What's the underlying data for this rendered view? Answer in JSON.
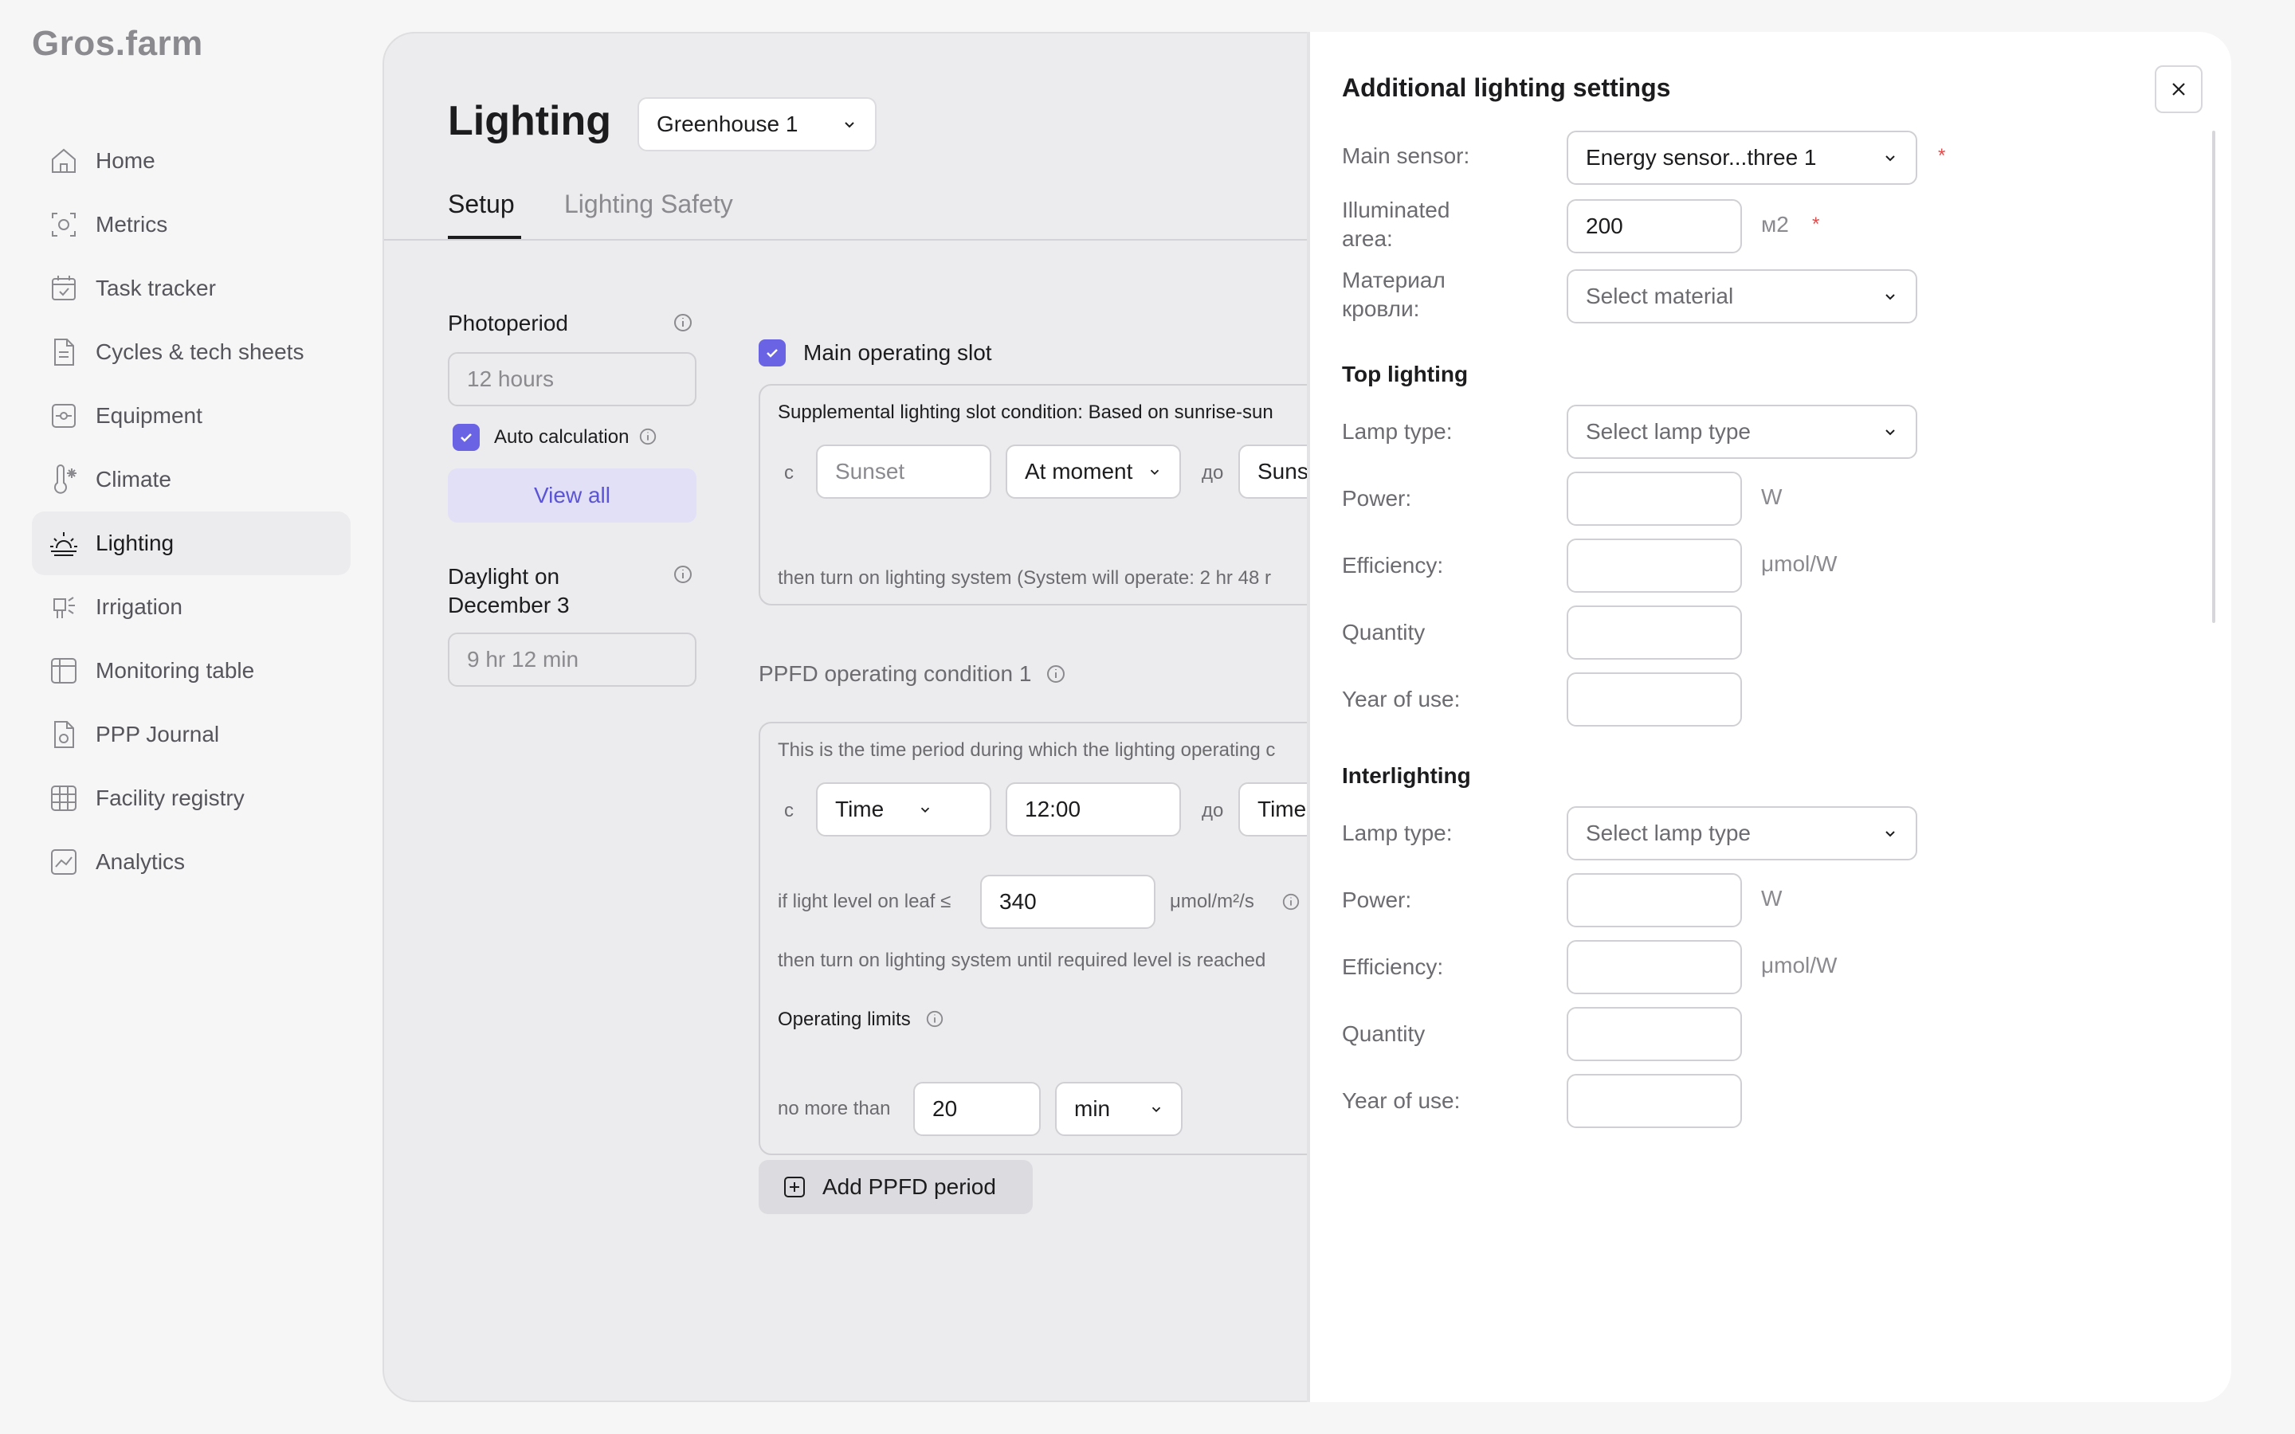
{
  "app": {
    "logo": "Gros.farm"
  },
  "sidebar": {
    "items": [
      {
        "label": "Home",
        "icon": "home-icon"
      },
      {
        "label": "Metrics",
        "icon": "metrics-icon"
      },
      {
        "label": "Task tracker",
        "icon": "calendar-check-icon"
      },
      {
        "label": "Cycles & tech sheets",
        "icon": "document-icon"
      },
      {
        "label": "Equipment",
        "icon": "equipment-icon"
      },
      {
        "label": "Climate",
        "icon": "thermometer-icon"
      },
      {
        "label": "Lighting",
        "icon": "sunrise-icon",
        "active": true
      },
      {
        "label": "Irrigation",
        "icon": "irrigation-icon"
      },
      {
        "label": "Monitoring table",
        "icon": "table-icon"
      },
      {
        "label": "PPP Journal",
        "icon": "journal-icon"
      },
      {
        "label": "Facility registry",
        "icon": "grid-icon"
      },
      {
        "label": "Analytics",
        "icon": "analytics-icon"
      }
    ]
  },
  "main": {
    "title": "Lighting",
    "greenhouse": "Greenhouse 1",
    "tabs": [
      {
        "label": "Setup",
        "active": true
      },
      {
        "label": "Lighting Safety"
      }
    ],
    "photoperiod": {
      "label": "Photoperiod",
      "value": "12 hours",
      "auto_calc_label": "Auto calculation",
      "view_all": "View all"
    },
    "daylight": {
      "label": "Daylight on December 3",
      "value": "9 hr 12 min"
    },
    "main_slot": {
      "label": "Main operating slot",
      "condition_title": "Supplemental lighting slot condition: Based on sunrise-sun",
      "from_prefix": "с",
      "from_value": "Sunset",
      "moment": "At moment",
      "to_prefix": "до",
      "to_value": "Suns",
      "footer": "then turn on lighting system (System will operate: 2 hr 48 r"
    },
    "ppfd": {
      "title": "PPFD operating condition 1",
      "description": "This is the time period during which the lighting operating c",
      "from_prefix": "с",
      "from_type": "Time",
      "from_time": "12:00",
      "to_prefix": "до",
      "to_type": "Time",
      "light_label": "if light level on leaf ≤",
      "light_value": "340",
      "light_unit": "μmol/m²/s",
      "then_text": "then turn on lighting system until required level is reached",
      "limits_label": "Operating limits",
      "no_more_than": "no more than",
      "limit_value": "20",
      "limit_unit": "min"
    },
    "add_ppfd": "Add PPFD period"
  },
  "panel": {
    "title": "Additional lighting settings",
    "main_sensor_label": "Main sensor:",
    "main_sensor_value": "Energy sensor...three 1",
    "area_label": "Illuminated area:",
    "area_value": "200",
    "area_unit": "м2",
    "roof_label": "Материал кровли:",
    "roof_placeholder": "Select material",
    "required_mark": "*",
    "top": {
      "title": "Top lighting",
      "lamp_label": "Lamp type:",
      "lamp_placeholder": "Select lamp type",
      "power_label": "Power:",
      "power_unit": "W",
      "eff_label": "Efficiency:",
      "eff_unit": "μmol/W",
      "qty_label": "Quantity",
      "year_label": "Year of use:"
    },
    "inter": {
      "title": "Interlighting",
      "lamp_label": "Lamp type:",
      "lamp_placeholder": "Select lamp type",
      "power_label": "Power:",
      "power_unit": "W",
      "eff_label": "Efficiency:",
      "eff_unit": "μmol/W",
      "qty_label": "Quantity",
      "year_label": "Year of use:"
    }
  },
  "colors": {
    "accent": "#6a63e4",
    "required": "#e34b4b"
  }
}
